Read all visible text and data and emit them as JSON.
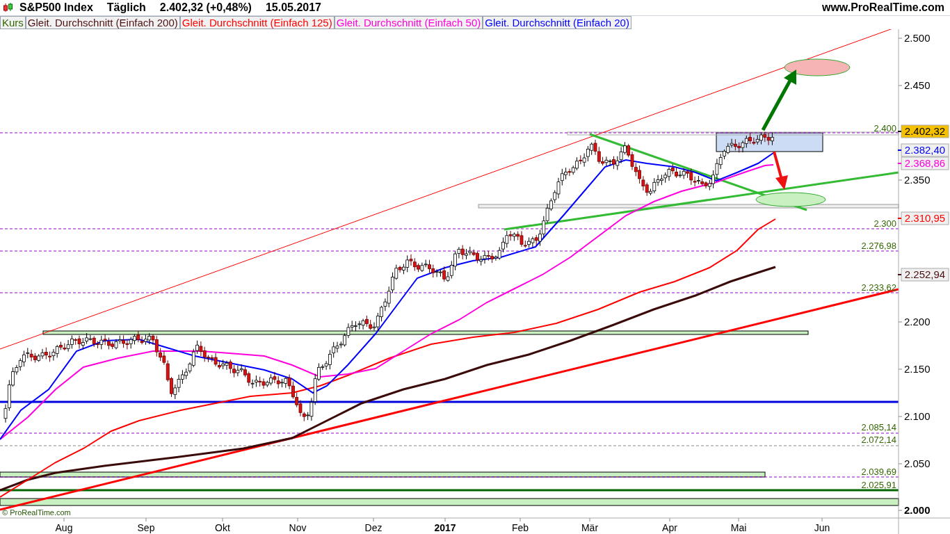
{
  "header": {
    "title": "S&P500 Index",
    "period": "Täglich",
    "price": "2.402,32 (+0,48%)",
    "date": "15.05.2017",
    "site": "www.ProRealTime.com"
  },
  "legend": [
    {
      "label": "Kurs",
      "color": "#336600"
    },
    {
      "label": "Gleit. Durchschnitt (Einfach 200)",
      "color": "#4d1010"
    },
    {
      "label": "Gleit. Durchschnitt (Einfach 125)",
      "color": "#ff0000"
    },
    {
      "label": "Gleit. Durchschnitt (Einfach 50)",
      "color": "#ff00dd"
    },
    {
      "label": "Gleit. Durchschnitt (Einfach 20)",
      "color": "#0000ff"
    }
  ],
  "y_axis": {
    "ticks": [
      {
        "label": "2.500",
        "bold": false
      },
      {
        "label": "2.450",
        "bold": false
      },
      {
        "label": "2.350",
        "bold": false
      },
      {
        "label": "2.200",
        "bold": false
      },
      {
        "label": "2.150",
        "bold": false
      },
      {
        "label": "2.100",
        "bold": false
      },
      {
        "label": "2.050",
        "bold": false
      },
      {
        "label": "2.000",
        "bold": true
      }
    ]
  },
  "x_axis": {
    "ticks": [
      {
        "label": "Aug",
        "bold": false
      },
      {
        "label": "Sep",
        "bold": false
      },
      {
        "label": "Okt",
        "bold": false
      },
      {
        "label": "Nov",
        "bold": false
      },
      {
        "label": "Dez",
        "bold": false
      },
      {
        "label": "2017",
        "bold": true
      },
      {
        "label": "Feb",
        "bold": false
      },
      {
        "label": "Mär",
        "bold": false
      },
      {
        "label": "Apr",
        "bold": false
      },
      {
        "label": "Mai",
        "bold": false
      },
      {
        "label": "Jun",
        "bold": false
      }
    ]
  },
  "price_markers": [
    {
      "label": "2.402,32",
      "color": "#000000",
      "highlighted": true
    },
    {
      "label": "2.382,40",
      "color": "#0000ff",
      "highlighted": false
    },
    {
      "label": "2.368,86",
      "color": "#ff00dd",
      "highlighted": false
    },
    {
      "label": "2.310,95",
      "color": "#ff0000",
      "highlighted": false
    },
    {
      "label": "2.252,94",
      "color": "#4d1010",
      "highlighted": false
    }
  ],
  "level_labels": [
    "2.400",
    "2.300",
    "2.276,98",
    "2.233,62",
    "2.085,14",
    "2.072,14",
    "2.039,69",
    "2.025,91"
  ],
  "copyright": "© ProRealTime.com"
}
